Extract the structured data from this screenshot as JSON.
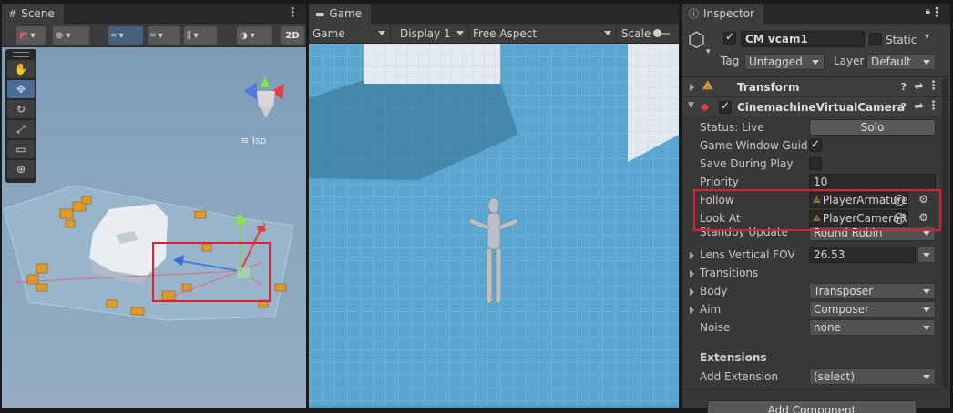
{
  "scene": {
    "tab_label": "Scene",
    "toolbar": {
      "mode_2d": "2D"
    },
    "iso_label": "Iso"
  },
  "game": {
    "tab_label": "Game",
    "toolbar": {
      "view_mode": "Game",
      "display": "Display 1",
      "aspect": "Free Aspect",
      "scale_label": "Scale"
    }
  },
  "inspector": {
    "tab_label": "Inspector",
    "object": {
      "name": "CM vcam1",
      "static_label": "Static",
      "tag_label": "Tag",
      "tag_value": "Untagged",
      "layer_label": "Layer",
      "layer_value": "Default"
    },
    "transform": {
      "title": "Transform"
    },
    "vcam": {
      "title": "CinemachineVirtualCamera",
      "status_label": "Status: Live",
      "solo_button": "Solo",
      "game_window_guides_label": "Game Window Guides",
      "save_during_play_label": "Save During Play",
      "priority_label": "Priority",
      "priority_value": "10",
      "follow_label": "Follow",
      "follow_value": "PlayerArmature",
      "look_at_label": "Look At",
      "look_at_value": "PlayerCameraRoot",
      "standby_label": "Standby Update",
      "standby_value": "Round Robin",
      "fov_label": "Lens Vertical FOV",
      "fov_value": "26.53",
      "transitions_label": "Transitions",
      "body_label": "Body",
      "body_value": "Transposer",
      "aim_label": "Aim",
      "aim_value": "Composer",
      "noise_label": "Noise",
      "noise_value": "none"
    },
    "extensions": {
      "title": "Extensions",
      "add_label": "Add Extension",
      "add_value": "(select)"
    },
    "add_component_button": "Add Component"
  },
  "colors": {
    "highlight": "#e0202f",
    "accent": "#46607c"
  }
}
